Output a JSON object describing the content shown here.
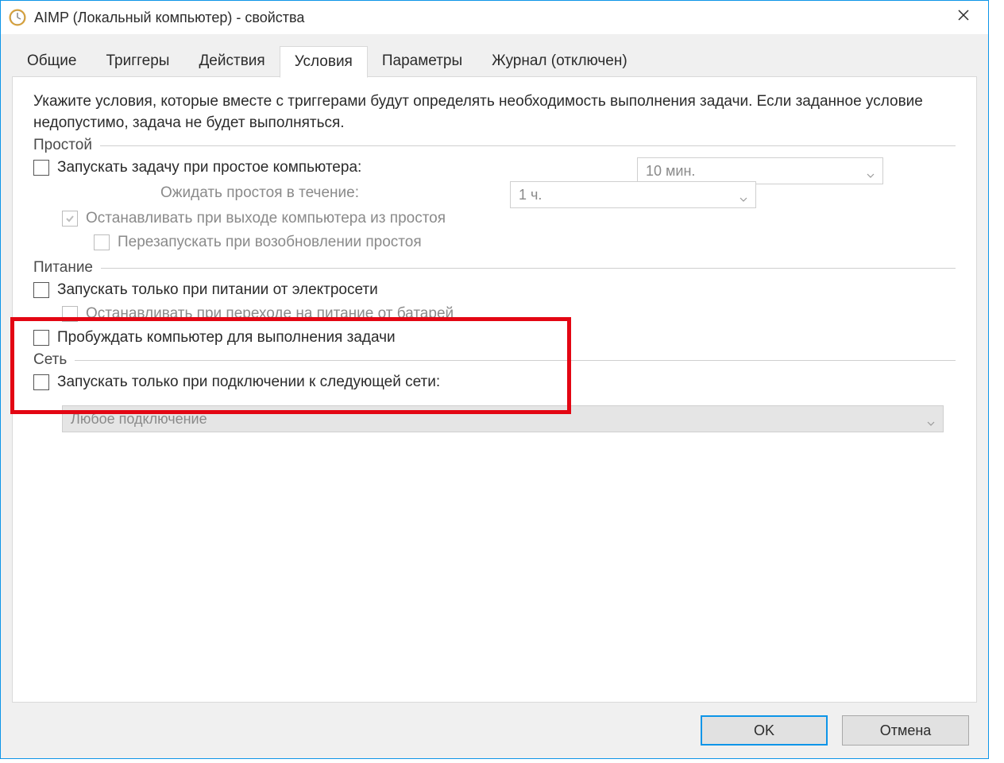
{
  "window": {
    "title": "AIMP (Локальный компьютер) - свойства"
  },
  "tabs": {
    "general": "Общие",
    "triggers": "Триггеры",
    "actions": "Действия",
    "conditions": "Условия",
    "settings": "Параметры",
    "history": "Журнал (отключен)"
  },
  "intro": "Укажите условия, которые вместе с триггерами будут определять необходимость выполнения задачи. Если заданное условие недопустимо, задача не будет выполняться.",
  "groups": {
    "idle": {
      "title": "Простой",
      "start_if_idle": "Запускать задачу при простое компьютера:",
      "wait_idle": "Ожидать простоя в течение:",
      "stop_on_idle_end": "Останавливать при выходе компьютера из простоя",
      "restart_on_idle_resume": "Перезапускать при возобновлении простоя",
      "idle_minutes": "10 мин.",
      "wait_hours": "1 ч."
    },
    "power": {
      "title": "Питание",
      "start_on_ac": "Запускать только при питании от электросети",
      "stop_on_battery": "Останавливать при переходе на питание от батарей",
      "wake": "Пробуждать компьютер для выполнения задачи"
    },
    "network": {
      "title": "Сеть",
      "start_on_network": "Запускать только при подключении к следующей сети:",
      "any_connection": "Любое подключение"
    }
  },
  "footer": {
    "ok": "OK",
    "cancel": "Отмена"
  }
}
